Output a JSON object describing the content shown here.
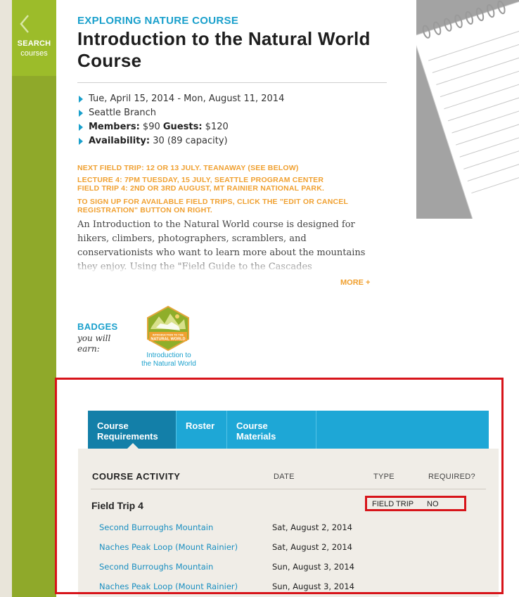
{
  "sidebar": {
    "search_label": "SEARCH",
    "search_sub": "courses"
  },
  "course": {
    "eyebrow": "EXPLORING NATURE COURSE",
    "title": "Introduction to the Natural World Course",
    "dates": "Tue, April 15, 2014 - Mon, August 11, 2014",
    "branch": "Seattle Branch",
    "members_label": "Members:",
    "members_price": "$90",
    "guests_label": "Guests:",
    "guests_price": "$120",
    "availability_label": "Availability:",
    "availability_value": "30 (89 capacity)"
  },
  "alerts": [
    "NEXT FIELD TRIP:  12 OR 13 JULY.  TEANAWAY (SEE BELOW)",
    "LECTURE 4: 7PM TUESDAY, 15 JULY, SEATTLE PROGRAM CENTER",
    "FIELD TRIP 4: 2ND OR 3RD AUGUST, MT RAINIER NATIONAL PARK.",
    "TO SIGN UP FOR AVAILABLE FIELD TRIPS, CLICK THE \"EDIT OR CANCEL",
    "REGISTRATION\" BUTTON ON RIGHT."
  ],
  "description": "An Introduction to the Natural World course is designed for hikers, climbers, photographers, scramblers, and conservationists who want to learn more about the mountains they enjoy. Using the \"Field Guide to the Cascades",
  "more_label": "MORE +",
  "badges": {
    "heading": "BADGES",
    "subtitle": "you will earn:",
    "badge_text_top": "INTRODUCTION TO THE",
    "badge_text_main": "NATURAL WORLD",
    "badge_caption_1": "Introduction to",
    "badge_caption_2": "the Natural World"
  },
  "tabs": [
    {
      "line1": "Course",
      "line2": "Requirements",
      "active": true
    },
    {
      "line1": "Roster",
      "line2": "",
      "active": false
    },
    {
      "line1": "Course",
      "line2": "Materials",
      "active": false
    }
  ],
  "table": {
    "headers": {
      "activity": "COURSE ACTIVITY",
      "date": "DATE",
      "type": "TYPE",
      "required": "REQUIRED?"
    },
    "group": {
      "name": "Field Trip 4",
      "type": "FIELD TRIP",
      "required": "NO"
    },
    "rows": [
      {
        "name": "Second Burroughs Mountain",
        "date": "Sat, August 2, 2014"
      },
      {
        "name": "Naches Peak Loop (Mount Rainier)",
        "date": "Sat, August 2, 2014"
      },
      {
        "name": "Second Burroughs Mountain",
        "date": "Sun, August 3, 2014"
      },
      {
        "name": "Naches Peak Loop (Mount Rainier)",
        "date": "Sun, August 3, 2014"
      }
    ]
  },
  "colors": {
    "accent_blue": "#1aa0cc",
    "accent_orange": "#f0a030",
    "sidebar_green": "#8fa92a",
    "highlight_red": "#d7141a"
  }
}
